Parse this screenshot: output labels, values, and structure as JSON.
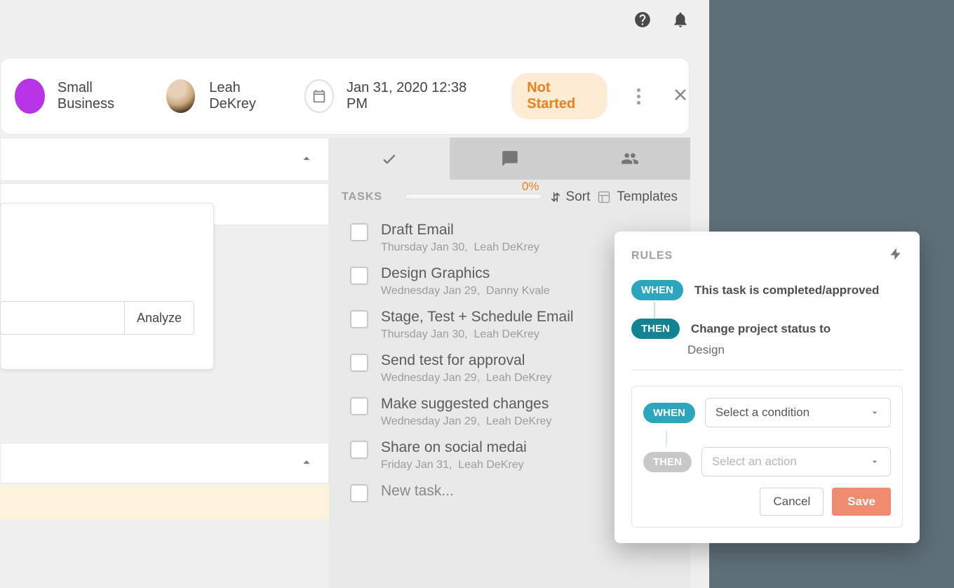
{
  "header": {
    "business_label": "Small Business",
    "user_name": "Leah DeKrey",
    "date": "Jan 31, 2020 12:38 PM",
    "status": "Not Started"
  },
  "left": {
    "analyze_label": "Analyze"
  },
  "tasks_panel": {
    "title": "TASKS",
    "progress_label": "0%",
    "sort_label": "Sort",
    "templates_label": "Templates",
    "tasks": [
      {
        "title": "Draft Email",
        "date": "Thursday Jan 30,",
        "assignee": "Leah DeKrey"
      },
      {
        "title": "Design Graphics",
        "date": "Wednesday Jan 29,",
        "assignee": "Danny Kvale"
      },
      {
        "title": "Stage, Test + Schedule Email",
        "date": "Thursday Jan 30,",
        "assignee": "Leah DeKrey"
      },
      {
        "title": "Send test for approval",
        "date": "Wednesday Jan 29,",
        "assignee": "Leah DeKrey"
      },
      {
        "title": "Make suggested changes",
        "date": "Wednesday Jan 29,",
        "assignee": "Leah DeKrey"
      },
      {
        "title": "Share on social medai",
        "date": "Friday Jan 31,",
        "assignee": "Leah DeKrey"
      }
    ],
    "new_task_placeholder": "New task..."
  },
  "rules": {
    "title": "RULES",
    "when_label": "WHEN",
    "then_label": "THEN",
    "existing": {
      "when_text": "This task is completed/approved",
      "then_text": "Change project status to",
      "then_value": "Design"
    },
    "builder": {
      "condition_placeholder": "Select a condition",
      "action_placeholder": "Select an action"
    },
    "cancel_label": "Cancel",
    "save_label": "Save"
  }
}
